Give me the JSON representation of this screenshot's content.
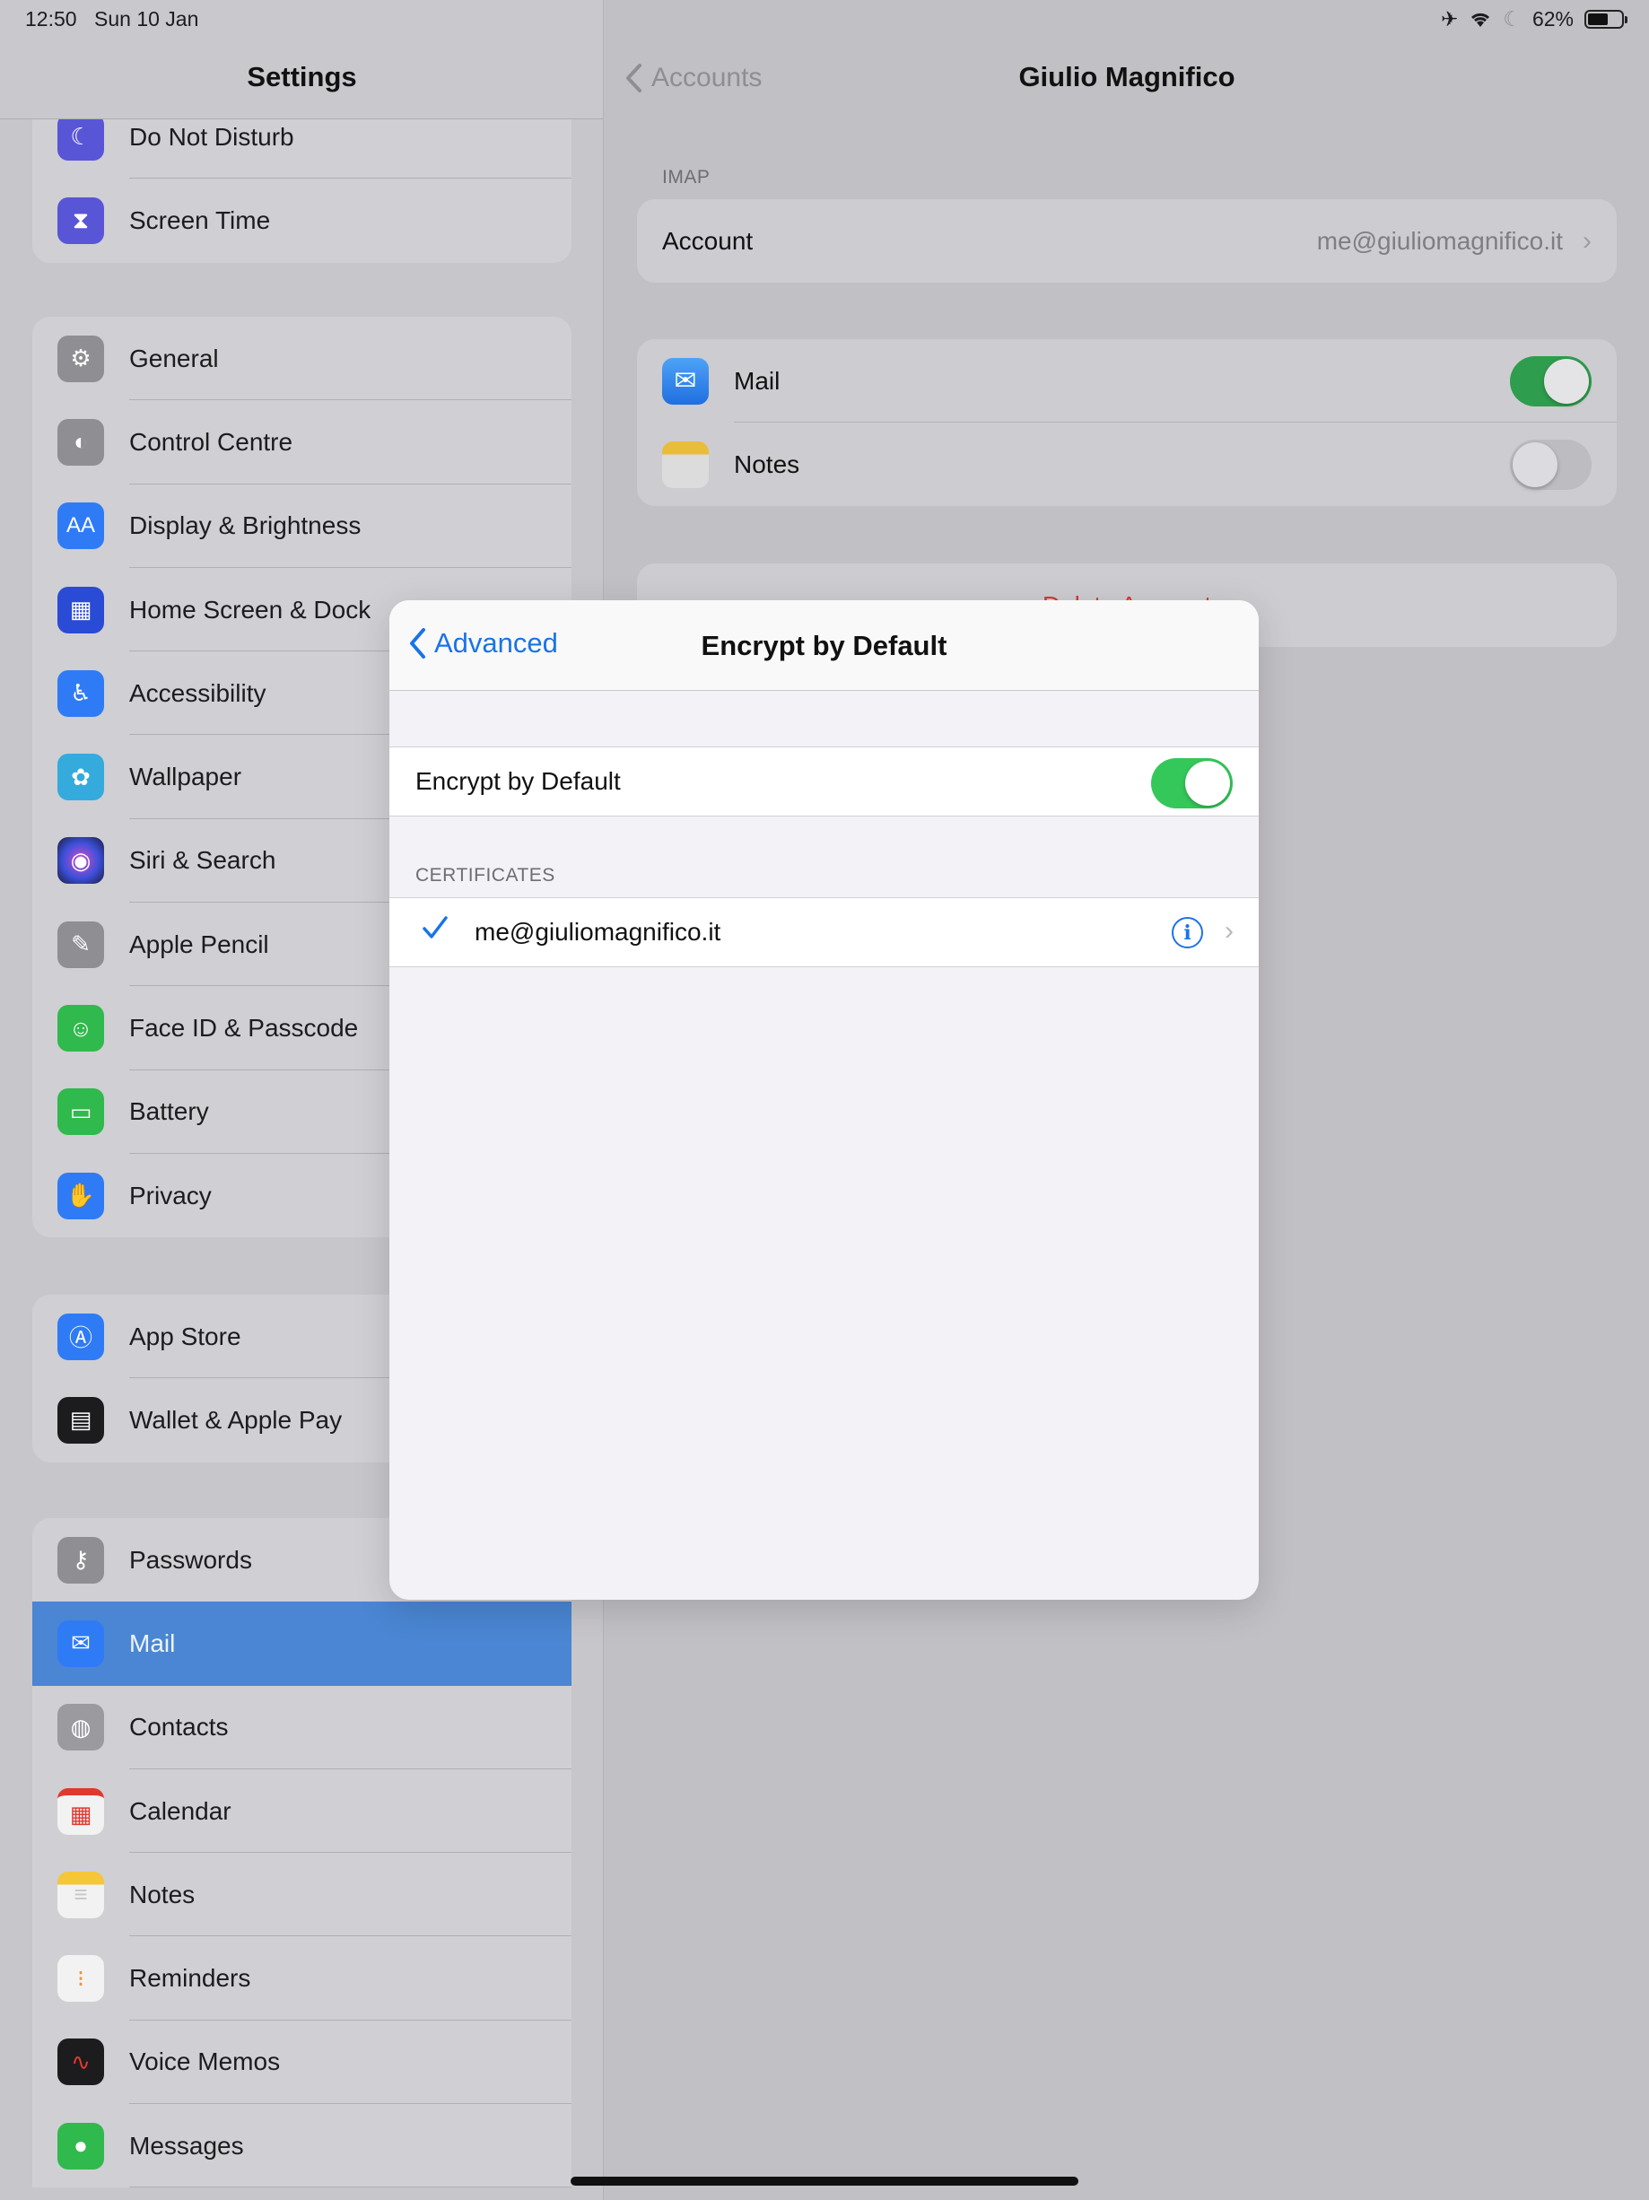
{
  "status_bar": {
    "time": "12:50",
    "date": "Sun 10 Jan",
    "battery": "62%"
  },
  "sidebar": {
    "title": "Settings",
    "groups": [
      {
        "items": [
          {
            "label": "Do Not Disturb",
            "icon": "moon-icon",
            "color": "#5856d6"
          },
          {
            "label": "Screen Time",
            "icon": "hourglass-icon",
            "color": "#5856d6"
          }
        ]
      },
      {
        "items": [
          {
            "label": "General",
            "icon": "gear-icon",
            "color": "#8e8e93"
          },
          {
            "label": "Control Centre",
            "icon": "switches-icon",
            "color": "#8e8e93"
          },
          {
            "label": "Display & Brightness",
            "icon": "text-size-icon",
            "color": "#2f7bf5"
          },
          {
            "label": "Home Screen & Dock",
            "icon": "app-grid-icon",
            "color": "#2a4bd6"
          },
          {
            "label": "Accessibility",
            "icon": "accessibility-icon",
            "color": "#2f7bf5"
          },
          {
            "label": "Wallpaper",
            "icon": "flower-icon",
            "color": "#35aadc"
          },
          {
            "label": "Siri & Search",
            "icon": "siri-icon",
            "color": "#1c1c3a"
          },
          {
            "label": "Apple Pencil",
            "icon": "pencil-icon",
            "color": "#8e8e93"
          },
          {
            "label": "Face ID & Passcode",
            "icon": "face-id-icon",
            "color": "#30b94d"
          },
          {
            "label": "Battery",
            "icon": "battery-icon",
            "color": "#30b94d"
          },
          {
            "label": "Privacy",
            "icon": "hand-icon",
            "color": "#2f7bf5"
          }
        ]
      },
      {
        "items": [
          {
            "label": "App Store",
            "icon": "app-store-icon",
            "color": "#2f7bf5"
          },
          {
            "label": "Wallet & Apple Pay",
            "icon": "wallet-icon",
            "color": "#1c1c1e"
          }
        ]
      },
      {
        "items": [
          {
            "label": "Passwords",
            "icon": "key-icon",
            "color": "#8e8e93"
          },
          {
            "label": "Mail",
            "icon": "envelope-icon",
            "color": "#2f7bf5",
            "selected": true
          },
          {
            "label": "Contacts",
            "icon": "contacts-icon",
            "color": "#9a9a9f"
          },
          {
            "label": "Calendar",
            "icon": "calendar-icon",
            "color": "#f2f2f2"
          },
          {
            "label": "Notes",
            "icon": "notes-icon",
            "color": "#f2f2f2"
          },
          {
            "label": "Reminders",
            "icon": "reminders-icon",
            "color": "#f2f2f2"
          },
          {
            "label": "Voice Memos",
            "icon": "waveform-icon",
            "color": "#1c1c1e"
          },
          {
            "label": "Messages",
            "icon": "speech-bubble-icon",
            "color": "#30b94d"
          }
        ]
      }
    ]
  },
  "detail": {
    "back_label": "Accounts",
    "title": "Giulio Magnifico",
    "imap_section": "IMAP",
    "account_label": "Account",
    "account_value": "me@giuliomagnifico.it",
    "services": [
      {
        "label": "Mail",
        "icon": "envelope-icon",
        "on": true
      },
      {
        "label": "Notes",
        "icon": "notes-icon",
        "on": false
      }
    ],
    "delete_label": "Delete Account"
  },
  "modal": {
    "back_label": "Advanced",
    "title": "Encrypt by Default",
    "toggle_label": "Encrypt by Default",
    "toggle_on": true,
    "certificates_section": "CERTIFICATES",
    "certificate": "me@giuliomagnifico.it"
  }
}
